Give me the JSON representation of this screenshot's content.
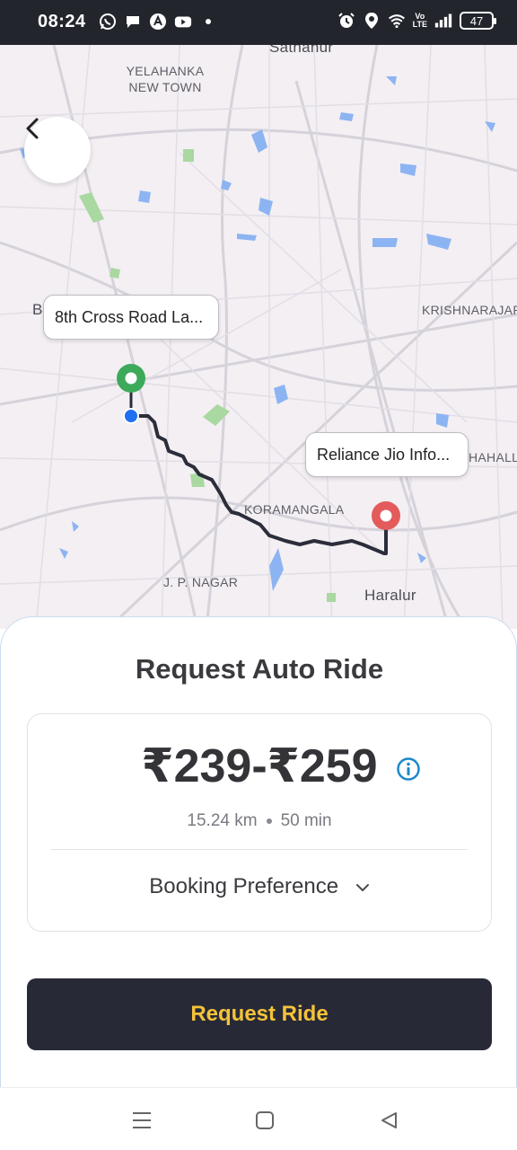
{
  "status_bar": {
    "time": "08:24",
    "battery": "47",
    "left_icons": [
      "whatsapp-icon",
      "chat-icon",
      "app-icon",
      "youtube-icon",
      "dot"
    ],
    "right_icons": [
      "alarm-icon",
      "location-icon",
      "wifi-icon",
      "volte-icon",
      "signal-icon",
      "battery-icon"
    ],
    "volte_top": "Vo",
    "volte_bottom": "LTE"
  },
  "map": {
    "labels": {
      "sathanur": "Sathanur",
      "yelahanka": "YELAHANKA\nNEW TOWN",
      "krishnarajap": "KRISHNARAJAP",
      "hahall": "HAHALL",
      "koramangala": "KORAMANGALA",
      "jp_nagar": "J. P. NAGAR",
      "haralur": "Haralur",
      "b": "B"
    },
    "pickup_callout": "8th Cross Road La...",
    "drop_callout": "Reliance Jio Info...",
    "colors": {
      "route": "#2b2d3a",
      "pickup": "#3caa5a",
      "drop": "#e35b5b",
      "water": "#8db4f2",
      "park": "#a9d8a0"
    }
  },
  "sheet": {
    "title": "Request Auto Ride",
    "fare": "₹239-₹259",
    "distance": "15.24 km",
    "duration": "50 min",
    "booking_preference": "Booking Preference",
    "request_button": "Request Ride",
    "colors": {
      "button_bg": "#272a36",
      "button_text": "#f5c23a",
      "info": "#1e88c9"
    }
  },
  "nav_bar": {
    "buttons": [
      "menu-icon",
      "home-icon",
      "back-icon"
    ]
  }
}
